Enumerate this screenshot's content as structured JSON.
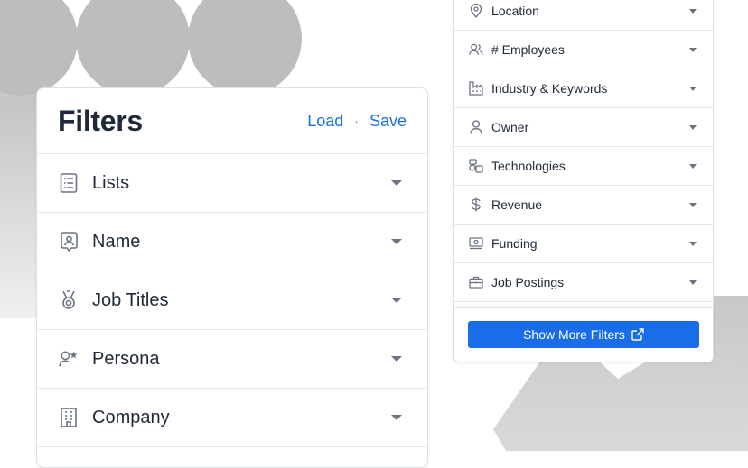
{
  "filters_panel": {
    "title": "Filters",
    "load_label": "Load",
    "separator": "·",
    "save_label": "Save",
    "items": [
      {
        "label": "Lists",
        "icon": "list-icon"
      },
      {
        "label": "Name",
        "icon": "id-badge-icon"
      },
      {
        "label": "Job Titles",
        "icon": "medal-icon"
      },
      {
        "label": "Persona",
        "icon": "person-star-icon"
      },
      {
        "label": "Company",
        "icon": "building-icon"
      }
    ]
  },
  "more_filters_panel": {
    "items": [
      {
        "label": "Location",
        "icon": "map-pin-icon"
      },
      {
        "label": "# Employees",
        "icon": "users-icon"
      },
      {
        "label": "Industry & Keywords",
        "icon": "factory-icon"
      },
      {
        "label": "Owner",
        "icon": "user-icon"
      },
      {
        "label": "Technologies",
        "icon": "technologies-icon"
      },
      {
        "label": "Revenue",
        "icon": "dollar-icon"
      },
      {
        "label": "Funding",
        "icon": "banknote-icon"
      },
      {
        "label": "Job Postings",
        "icon": "briefcase-icon"
      }
    ],
    "show_more_label": "Show More Filters"
  },
  "colors": {
    "accent": "#1a73d9",
    "button": "#1a6de8",
    "icon": "#6b7280"
  }
}
